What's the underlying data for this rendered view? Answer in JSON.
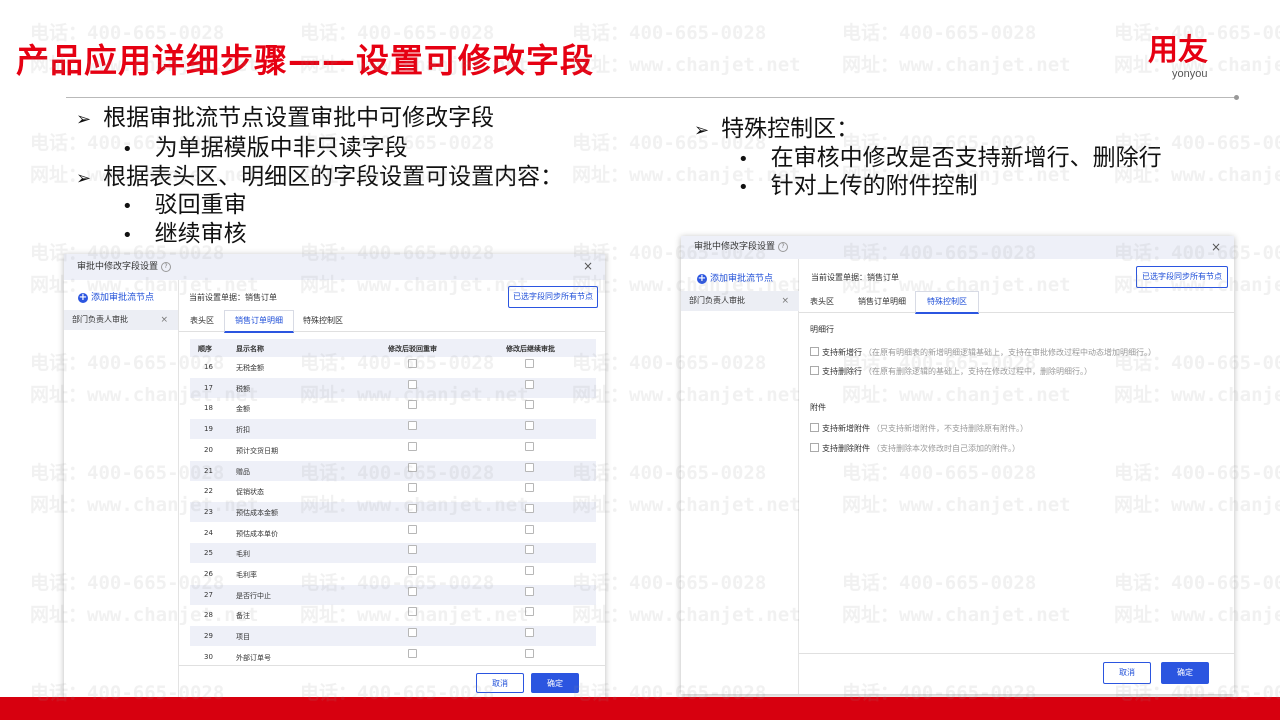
{
  "slide": {
    "title": "产品应用详细步骤——设置可修改字段",
    "logo_cn": "用友",
    "logo_en": "yonyou",
    "accent_color": "#e60012"
  },
  "watermark": {
    "phone": "电话：400-665-0028",
    "site": "网址：www.chanjet.net"
  },
  "bullets_left": [
    {
      "text": "根据审批流节点设置审批中可修改字段"
    },
    {
      "text": "为单据模版中非只读字段"
    },
    {
      "text": "根据表头区、明细区的字段设置可设置内容："
    },
    {
      "text": "驳回重审"
    },
    {
      "text": "继续审核"
    }
  ],
  "bullets_right": [
    {
      "text": "特殊控制区："
    },
    {
      "text": "在审核中修改是否支持新增行、删除行"
    },
    {
      "text": "针对上传的附件控制"
    }
  ],
  "dialog_left": {
    "title": "审批中修改字段设置",
    "help": "?",
    "close": "×",
    "add_node": "添加审批流节点",
    "node_name": "部门负责人审批",
    "node_remove": "×",
    "current_doc": "当前设置单据：销售订单",
    "sync_button": "已选字段同步所有节点",
    "tabs": [
      "表头区",
      "销售订单明细",
      "特殊控制区"
    ],
    "columns": [
      "顺序",
      "显示名称",
      "修改后驳回重审",
      "修改后继续审批"
    ],
    "rows": [
      {
        "no": "16",
        "name": "无税金额"
      },
      {
        "no": "17",
        "name": "税额"
      },
      {
        "no": "18",
        "name": "金额"
      },
      {
        "no": "19",
        "name": "折扣"
      },
      {
        "no": "20",
        "name": "预计交货日期"
      },
      {
        "no": "21",
        "name": "赠品"
      },
      {
        "no": "22",
        "name": "促销状态"
      },
      {
        "no": "23",
        "name": "预估成本金额"
      },
      {
        "no": "24",
        "name": "预估成本单价"
      },
      {
        "no": "25",
        "name": "毛利"
      },
      {
        "no": "26",
        "name": "毛利率"
      },
      {
        "no": "27",
        "name": "是否行中止"
      },
      {
        "no": "28",
        "name": "备注"
      },
      {
        "no": "29",
        "name": "项目"
      },
      {
        "no": "30",
        "name": "外部订单号"
      }
    ],
    "cancel": "取消",
    "confirm": "确定"
  },
  "dialog_right": {
    "title": "审批中修改字段设置",
    "help": "?",
    "close": "×",
    "add_node": "添加审批流节点",
    "node_name": "部门负责人审批",
    "node_remove": "×",
    "current_doc": "当前设置单据：销售订单",
    "sync_button": "已选字段同步所有节点",
    "tabs": [
      "表头区",
      "销售订单明细",
      "特殊控制区"
    ],
    "section_detail": "明细行",
    "opt_add_row": "支持新增行",
    "opt_add_row_hint": "（在原有明细表的新增明细逻辑基础上，支持在审批修改过程中动态增加明细行。）",
    "opt_del_row": "支持删除行",
    "opt_del_row_hint": "（在原有删除逻辑的基础上，支持在修改过程中，删除明细行。）",
    "section_attach": "附件",
    "opt_add_att": "支持新增附件",
    "opt_add_att_hint": "（只支持新增附件，不支持删除原有附件。）",
    "opt_del_att": "支持删除附件",
    "opt_del_att_hint": "（支持删除本次修改时自己添加的附件。）",
    "cancel": "取消",
    "confirm": "确定"
  }
}
